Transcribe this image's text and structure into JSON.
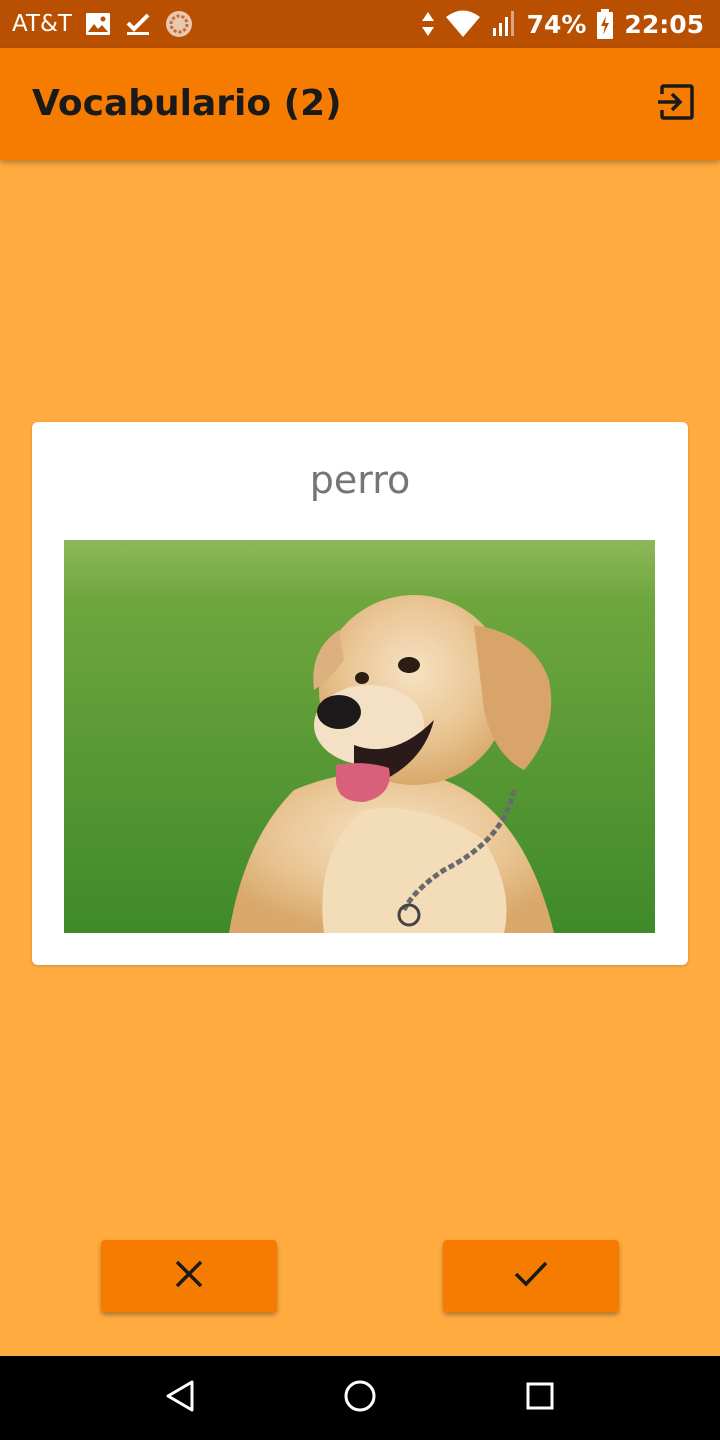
{
  "status_bar": {
    "carrier": "AT&T",
    "battery": "74%",
    "time": "22:05",
    "icons": [
      "image-icon",
      "download-done-icon",
      "sync-circle-icon",
      "data-arrows-icon",
      "wifi-icon",
      "signal-icon",
      "battery-charging-icon"
    ]
  },
  "app_bar": {
    "title": "Vocabulario (2)",
    "action_icon": "exit-icon"
  },
  "card": {
    "word": "perro",
    "image": "golden-retriever-photo"
  },
  "actions": {
    "wrong_icon": "close-icon",
    "right_icon": "check-icon"
  },
  "nav": {
    "icons": [
      "back-icon",
      "home-icon",
      "recents-icon"
    ]
  },
  "colors": {
    "status_bar": "#B94F00",
    "app_bar": "#F57C00",
    "background": "#FFAB40",
    "button": "#F57C00",
    "card": "#FFFFFF",
    "word_text": "#757575"
  }
}
